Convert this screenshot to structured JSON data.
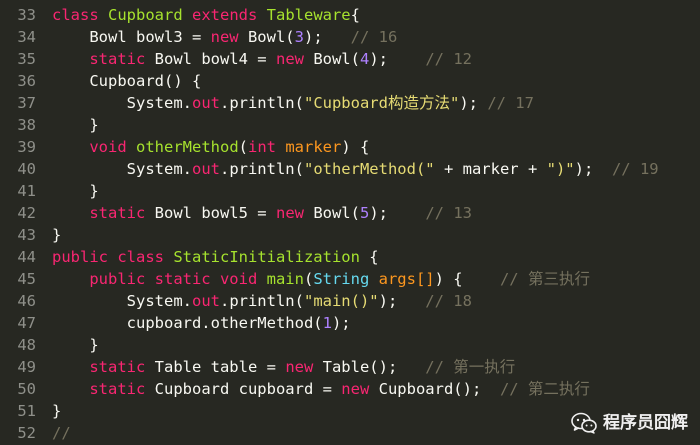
{
  "code": {
    "lines": [
      {
        "num": "33",
        "tokens": [
          [
            "kw",
            "class "
          ],
          [
            "cl",
            "Cupboard "
          ],
          [
            "kw",
            "extends "
          ],
          [
            "cl",
            "Tableware"
          ],
          [
            "",
            "{"
          ]
        ]
      },
      {
        "num": "34",
        "tokens": [
          [
            "",
            "    Bowl bowl3 = "
          ],
          [
            "kw",
            "new "
          ],
          [
            "",
            "Bowl("
          ],
          [
            "nm",
            "3"
          ],
          [
            "",
            "); "
          ],
          [
            "cm",
            "  // 16"
          ]
        ]
      },
      {
        "num": "35",
        "tokens": [
          [
            "",
            "    "
          ],
          [
            "kw",
            "static "
          ],
          [
            "",
            "Bowl bowl4 = "
          ],
          [
            "kw",
            "new "
          ],
          [
            "",
            "Bowl("
          ],
          [
            "nm",
            "4"
          ],
          [
            "",
            "); "
          ],
          [
            "cm",
            "   // 12"
          ]
        ]
      },
      {
        "num": "36",
        "tokens": [
          [
            "",
            "    Cupboard() {"
          ]
        ]
      },
      {
        "num": "37",
        "tokens": [
          [
            "",
            "        System."
          ],
          [
            "kw",
            "out"
          ],
          [
            "",
            ".println("
          ],
          [
            "st",
            "\"Cupboard构造方法\""
          ],
          [
            "",
            "); "
          ],
          [
            "cm",
            "// 17"
          ]
        ]
      },
      {
        "num": "38",
        "tokens": [
          [
            "",
            "    }"
          ]
        ]
      },
      {
        "num": "39",
        "tokens": [
          [
            "",
            "    "
          ],
          [
            "kw",
            "void "
          ],
          [
            "cl",
            "otherMethod"
          ],
          [
            "",
            "("
          ],
          [
            "kw",
            "int "
          ],
          [
            "pa",
            "marker"
          ],
          [
            "",
            ") {"
          ]
        ]
      },
      {
        "num": "40",
        "tokens": [
          [
            "",
            "        System."
          ],
          [
            "kw",
            "out"
          ],
          [
            "",
            ".println("
          ],
          [
            "st",
            "\"otherMethod(\""
          ],
          [
            "",
            " + marker + "
          ],
          [
            "st",
            "\")\""
          ],
          [
            "",
            "); "
          ],
          [
            "cm",
            " // 19"
          ]
        ]
      },
      {
        "num": "41",
        "tokens": [
          [
            "",
            "    }"
          ]
        ]
      },
      {
        "num": "42",
        "tokens": [
          [
            "",
            "    "
          ],
          [
            "kw",
            "static "
          ],
          [
            "",
            "Bowl bowl5 = "
          ],
          [
            "kw",
            "new "
          ],
          [
            "",
            "Bowl("
          ],
          [
            "nm",
            "5"
          ],
          [
            "",
            "); "
          ],
          [
            "cm",
            "   // 13"
          ]
        ]
      },
      {
        "num": "43",
        "tokens": [
          [
            "",
            "}"
          ]
        ]
      },
      {
        "num": "44",
        "tokens": [
          [
            "kw",
            "public class "
          ],
          [
            "cl",
            "StaticInitialization "
          ],
          [
            "",
            "{"
          ]
        ]
      },
      {
        "num": "45",
        "tokens": [
          [
            "",
            "    "
          ],
          [
            "kw",
            "public static void "
          ],
          [
            "cl",
            "main"
          ],
          [
            "",
            "("
          ],
          [
            "ty",
            "String "
          ],
          [
            "pa",
            "args[]"
          ],
          [
            "",
            ") { "
          ],
          [
            "cm",
            "   // 第三执行"
          ]
        ]
      },
      {
        "num": "46",
        "tokens": [
          [
            "",
            "        System."
          ],
          [
            "kw",
            "out"
          ],
          [
            "",
            ".println("
          ],
          [
            "st",
            "\"main()\""
          ],
          [
            "",
            "); "
          ],
          [
            "cm",
            "  // 18"
          ]
        ]
      },
      {
        "num": "47",
        "tokens": [
          [
            "",
            "        cupboard.otherMethod("
          ],
          [
            "nm",
            "1"
          ],
          [
            "",
            ");"
          ]
        ]
      },
      {
        "num": "48",
        "tokens": [
          [
            "",
            "    }"
          ]
        ]
      },
      {
        "num": "49",
        "tokens": [
          [
            "",
            "    "
          ],
          [
            "kw",
            "static "
          ],
          [
            "",
            "Table table = "
          ],
          [
            "kw",
            "new "
          ],
          [
            "",
            "Table(); "
          ],
          [
            "cm",
            "  // 第一执行"
          ]
        ]
      },
      {
        "num": "50",
        "tokens": [
          [
            "",
            "    "
          ],
          [
            "kw",
            "static "
          ],
          [
            "",
            "Cupboard cupboard = "
          ],
          [
            "kw",
            "new "
          ],
          [
            "",
            "Cupboard(); "
          ],
          [
            "cm",
            " // 第二执行"
          ]
        ]
      },
      {
        "num": "51",
        "tokens": [
          [
            "",
            "}"
          ]
        ]
      },
      {
        "num": "52",
        "tokens": [
          [
            "cm",
            "//"
          ]
        ]
      }
    ]
  },
  "watermark": {
    "text": "程序员囧辉",
    "icon": "wechat-icon"
  },
  "colors": {
    "background": "#272822",
    "keyword": "#f92672",
    "type": "#66d9ef",
    "class_name": "#a6e22e",
    "number": "#ae81ff",
    "string": "#e6db74",
    "comment": "#75715e",
    "parameter": "#fd971f",
    "gutter": "#8f908a"
  }
}
